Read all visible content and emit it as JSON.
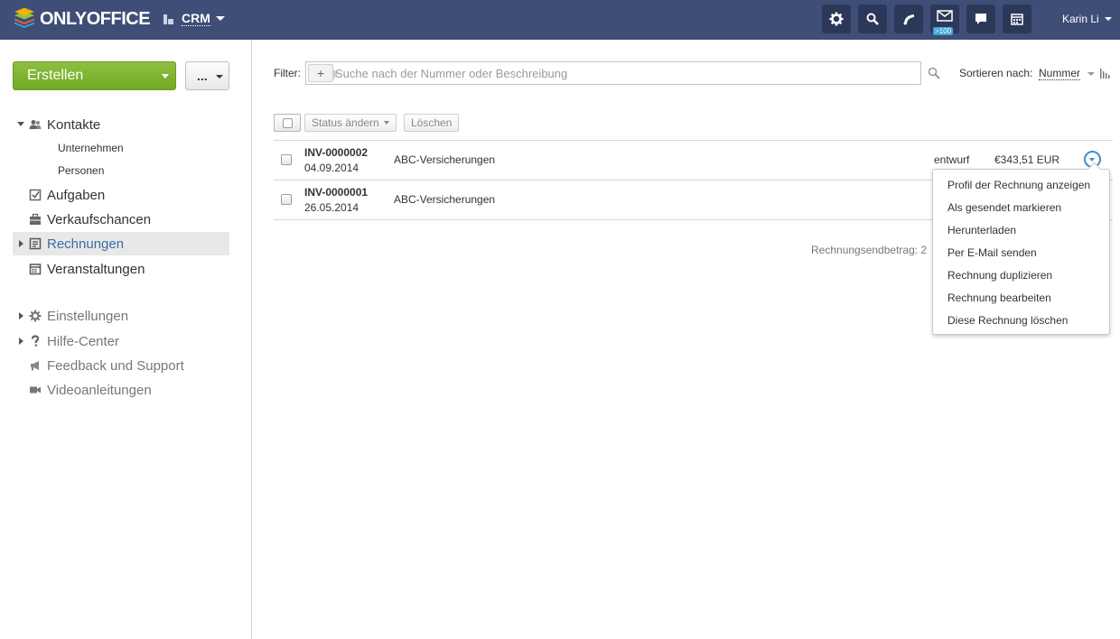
{
  "header": {
    "logo_text": "ONLYOFFICE",
    "module_label": "CRM",
    "notification_badge": ">100",
    "user_name": "Karin Li",
    "bg_color": "#3f4e77"
  },
  "sidebar": {
    "create_label": "Erstellen",
    "more_label": "...",
    "items": [
      {
        "label": "Kontakte",
        "icon": "contacts-icon"
      },
      {
        "label": "Aufgaben",
        "icon": "tasks-icon"
      },
      {
        "label": "Verkaufschancen",
        "icon": "opportunities-icon"
      },
      {
        "label": "Rechnungen",
        "icon": "invoices-icon"
      },
      {
        "label": "Veranstaltungen",
        "icon": "events-icon"
      },
      {
        "label": "Einstellungen",
        "icon": "gear-icon"
      },
      {
        "label": "Hilfe-Center",
        "icon": "help-icon"
      },
      {
        "label": "Feedback und Support",
        "icon": "megaphone-icon"
      },
      {
        "label": "Videoanleitungen",
        "icon": "video-icon"
      }
    ],
    "sub_items": [
      "Unternehmen",
      "Personen"
    ]
  },
  "filter": {
    "label": "Filter:",
    "plus": "+",
    "placeholder": "Suche nach der Nummer oder Beschreibung",
    "sort_label": "Sortieren nach:",
    "sort_value": "Nummer"
  },
  "toolbar": {
    "status_label": "Status ändern",
    "delete_label": "Löschen"
  },
  "invoices": [
    {
      "number": "INV-0000002",
      "date": "04.09.2014",
      "contact": "ABC-Versicherungen",
      "status": "entwurf",
      "amount": "€343,51 EUR"
    },
    {
      "number": "INV-0000001",
      "date": "26.05.2014",
      "contact": "ABC-Versicherungen",
      "status": "",
      "amount": ""
    }
  ],
  "total_label": "Rechnungsendbetrag: 2",
  "dropdown_items": [
    "Profil der Rechnung anzeigen",
    "Als gesendet markieren",
    "Herunterladen",
    "Per E-Mail senden",
    "Rechnung duplizieren",
    "Rechnung bearbeiten",
    "Diese Rechnung löschen"
  ]
}
